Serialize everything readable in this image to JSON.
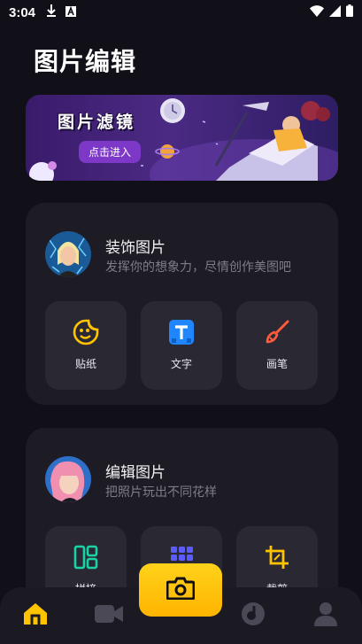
{
  "status_bar": {
    "time": "3:04",
    "icons": [
      "download-icon",
      "a-icon",
      "wifi-icon",
      "signal-icon",
      "battery-icon"
    ]
  },
  "page": {
    "title": "图片编辑"
  },
  "banner": {
    "title": "图片滤镜",
    "button_label": "点击进入"
  },
  "decorate_card": {
    "title": "装饰图片",
    "subtitle": "发挥你的想象力，尽情创作美图吧",
    "tools": [
      {
        "label": "贴纸",
        "icon": "sticker-smile-icon"
      },
      {
        "label": "文字",
        "icon": "text-t-icon"
      },
      {
        "label": "画笔",
        "icon": "paint-brush-icon"
      }
    ]
  },
  "edit_card": {
    "title": "编辑图片",
    "subtitle": "把照片玩出不同花样",
    "tools": [
      {
        "label": "拼接",
        "icon": "collage-icon"
      },
      {
        "label": "",
        "icon": "grid-dots-icon"
      },
      {
        "label": "裁剪",
        "icon": "crop-icon"
      }
    ]
  },
  "tab_bar": {
    "tabs": [
      {
        "name": "home",
        "icon": "home-icon",
        "active": true
      },
      {
        "name": "video",
        "icon": "video-camera-icon",
        "active": false
      },
      {
        "name": "camera",
        "icon": "camera-icon",
        "active": false
      },
      {
        "name": "music",
        "icon": "music-disc-icon",
        "active": false
      },
      {
        "name": "profile",
        "icon": "user-icon",
        "active": false
      }
    ]
  },
  "colors": {
    "background": "#111018",
    "card": "#1d1c25",
    "tool_tile": "#2a2933",
    "accent_yellow": "#ffc400",
    "banner_purple": "#4b2a84",
    "banner_button": "#7d38c8",
    "subtitle_gray": "#7e7d86"
  }
}
